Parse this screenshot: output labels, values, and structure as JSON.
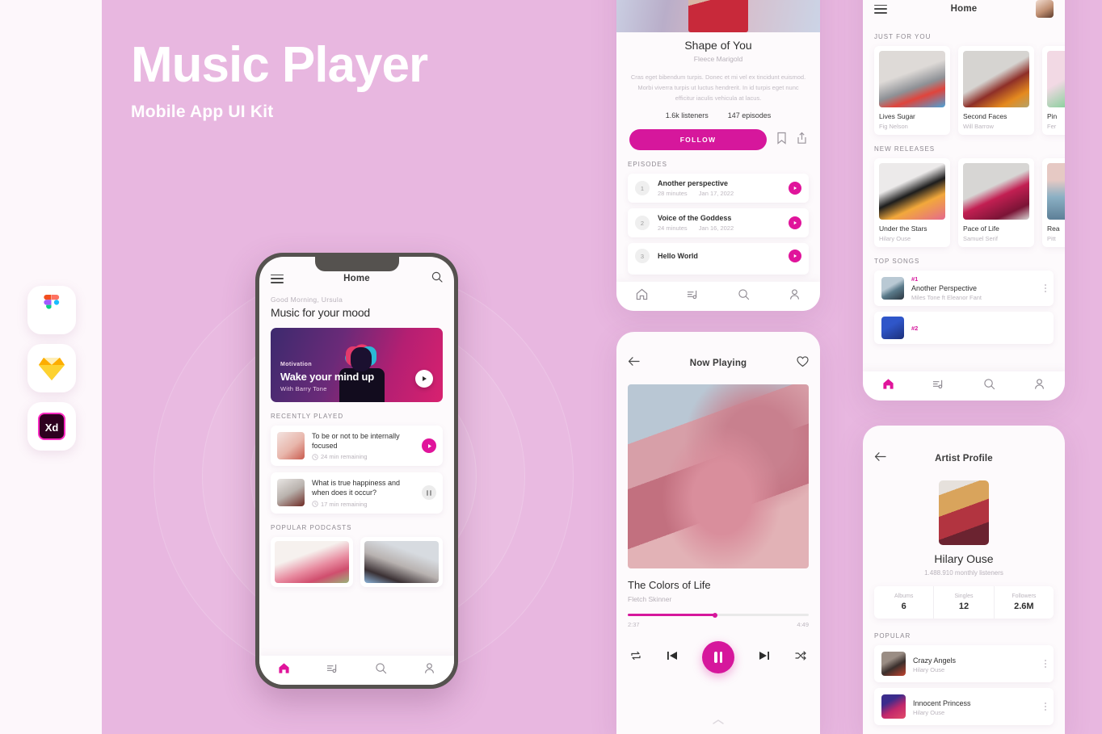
{
  "meta": {
    "bg_left": "#fdf7fb",
    "bg_panel": "#e8b7e0",
    "accent": "#d6179c"
  },
  "hero_title": "Music Player",
  "hero_subtitle": "Mobile App UI Kit",
  "tools": [
    {
      "name": "figma-icon",
      "label": "Figma"
    },
    {
      "name": "sketch-icon",
      "label": "Sketch"
    },
    {
      "name": "adobe-xd-icon",
      "label": "Xd"
    }
  ],
  "screen_home": {
    "title": "Home",
    "greeting": "Good Morning, Ursula",
    "headline": "Music for your mood",
    "hero": {
      "kicker": "Motivation",
      "title": "Wake your mind up",
      "subtitle": "With Barry Tone"
    },
    "recently_played_label": "RECENTLY PLAYED",
    "recently_played": [
      {
        "title": "To be or not to be internally focused",
        "meta": "24 min remaining",
        "state": "play"
      },
      {
        "title": "What is true happiness and when does it occur?",
        "meta": "17 min remaining",
        "state": "pause"
      }
    ],
    "popular_label": "POPULAR PODCASTS",
    "tabs": [
      "home-icon",
      "playlist-icon",
      "search-icon",
      "profile-icon"
    ]
  },
  "screen_podcast": {
    "title": "Shape of You",
    "author": "Fleece Marigold",
    "description": "Cras eget bibendum turpis. Donec et mi vel ex tincidunt euismod. Morbi viverra turpis ut luctus hendrerit. In id turpis eget nunc efficitur iaculis vehicula at lacus.",
    "listeners": "1.6k listeners",
    "episodes_count": "147 episodes",
    "follow_label": "FOLLOW",
    "episodes_label": "EPISODES",
    "episodes": [
      {
        "num": "1",
        "title": "Another perspective",
        "duration": "28 minutes",
        "date": "Jan 17, 2022"
      },
      {
        "num": "2",
        "title": "Voice of the Goddess",
        "duration": "24 minutes",
        "date": "Jan 16, 2022"
      },
      {
        "num": "3",
        "title": "Hello World",
        "duration": "",
        "date": ""
      }
    ]
  },
  "screen_now_playing": {
    "title": "Now Playing",
    "song": "The Colors of Life",
    "artist": "Fletch Skinner",
    "elapsed": "2:37",
    "total": "4:49",
    "progress_percent": 48
  },
  "screen_browse": {
    "title": "Home",
    "just_for_you_label": "JUST FOR YOU",
    "just_for_you": [
      {
        "title": "Lives Sugar",
        "artist": "Fig Nelson"
      },
      {
        "title": "Second Faces",
        "artist": "Will Barrow"
      },
      {
        "title": "Pin",
        "artist": "Fer"
      }
    ],
    "new_releases_label": "NEW RELEASES",
    "new_releases": [
      {
        "title": "Under the Stars",
        "artist": "Hilary Ouse"
      },
      {
        "title": "Pace of Life",
        "artist": "Samuel Serif"
      },
      {
        "title": "Rea",
        "artist": "Pitt"
      }
    ],
    "top_songs_label": "TOP SONGS",
    "top_songs": [
      {
        "rank": "#1",
        "title": "Another Perspective",
        "artist": "Miles Tone ft Eleanor Fant"
      },
      {
        "rank": "#2",
        "title": "",
        "artist": ""
      }
    ]
  },
  "screen_artist": {
    "title": "Artist Profile",
    "name": "Hilary Ouse",
    "listeners": "1.488.910 monthly listeners",
    "stats": [
      {
        "key": "Albums",
        "value": "6"
      },
      {
        "key": "Singles",
        "value": "12"
      },
      {
        "key": "Followers",
        "value": "2.6M"
      }
    ],
    "popular_label": "POPULAR",
    "popular": [
      {
        "title": "Crazy Angels",
        "artist": "Hilary Ouse"
      },
      {
        "title": "Innocent Princess",
        "artist": "Hilary Ouse"
      }
    ]
  }
}
